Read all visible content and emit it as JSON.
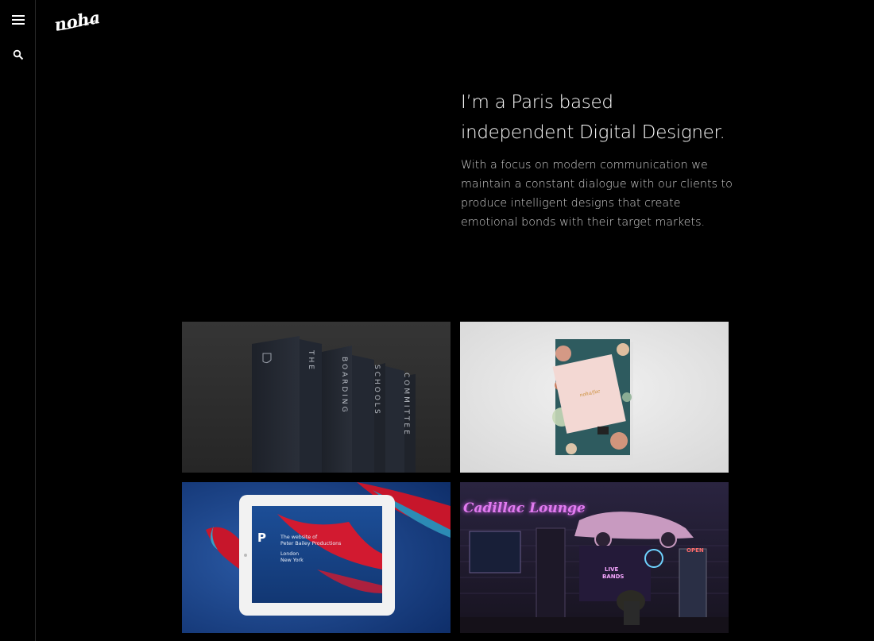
{
  "brand": {
    "logo_text": "noha"
  },
  "sidebar": {
    "menu_icon": "hamburger-menu-icon",
    "search_icon": "search-icon"
  },
  "hero": {
    "title_line1": "I’m a Paris based",
    "title_line2": "independent Digital Designer.",
    "body_line1": "With a focus on modern communication we",
    "body_line2": "maintain a constant dialogue with our clients to",
    "body_line3": "produce intelligent designs that create",
    "body_line4": "emotional bonds with their target markets."
  },
  "projects": [
    {
      "name": "boarding-schools-banners",
      "banner_texts": [
        "THE",
        "BOARDING",
        "SCHOOLS",
        "COMMITTEE"
      ]
    },
    {
      "name": "notebook-mockup",
      "label": "noha/fac"
    },
    {
      "name": "peter-bailey-tablet",
      "logo_letter": "P",
      "line1": "The website of",
      "line2": "Peter Bailey Productions",
      "line3": "London",
      "line4": "New York"
    },
    {
      "name": "cadillac-lounge",
      "sign": "Cadillac Lounge",
      "neon1": "LIVE",
      "neon2": "BANDS",
      "neon3": "OPEN"
    }
  ],
  "colors": {
    "background": "#000000",
    "text": "#ffffff",
    "muted_text": "#c9c9c9"
  }
}
